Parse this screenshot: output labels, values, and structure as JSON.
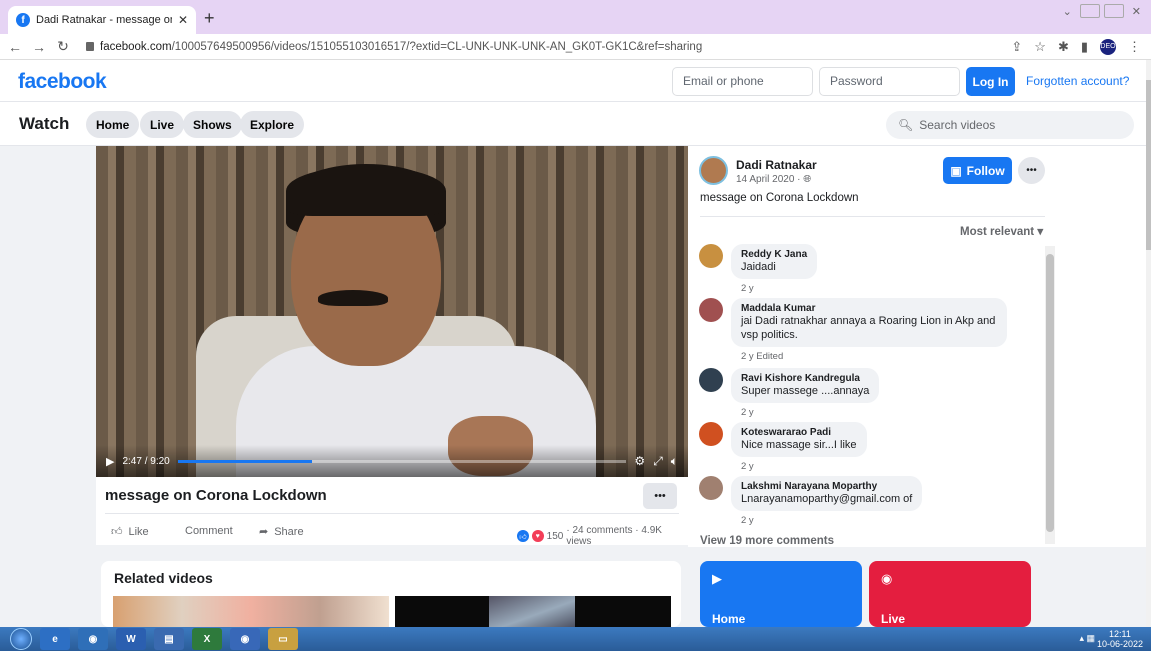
{
  "browser": {
    "tab_title": "Dadi Ratnakar - message on Cor",
    "url_host": "facebook.com",
    "url_path": "/100057649500956/videos/151055103016517/?extid=CL-UNK-UNK-UNK-AN_GK0T-GK1C&ref=sharing"
  },
  "header": {
    "logo": "facebook",
    "email_placeholder": "Email or phone",
    "password_placeholder": "Password",
    "login_label": "Log In",
    "forgot_label": "Forgotten account?"
  },
  "watch": {
    "title": "Watch",
    "nav": [
      "Home",
      "Live",
      "Shows",
      "Explore"
    ],
    "search_placeholder": "Search videos"
  },
  "video": {
    "time": "2:47 / 9:20",
    "progress": 0.3,
    "title": "message on Corona Lockdown",
    "actions": {
      "like": "Like",
      "comment": "Comment",
      "share": "Share"
    },
    "reactions_count": "150",
    "stats": "· 24 comments · 4.9K views"
  },
  "post": {
    "author": "Dadi Ratnakar",
    "date": "14 April 2020 · ",
    "description": "message on Corona Lockdown",
    "follow_label": "Follow",
    "sort_label": "Most relevant",
    "view_more": "View 19 more comments"
  },
  "comments": [
    {
      "name": "Reddy K Jana",
      "text": "Jaidadi",
      "meta": "2 y",
      "color": "#c89040"
    },
    {
      "name": "Maddala Kumar",
      "text": "jai Dadi ratnakhar annaya a Roaring Lion in Akp and vsp politics.",
      "meta": "2 y   Edited",
      "color": "#a05050"
    },
    {
      "name": "Ravi Kishore Kandregula",
      "text": "Super massege ....annaya",
      "meta": "2 y",
      "color": "#304050"
    },
    {
      "name": "Koteswararao Padi",
      "text": "Nice massage sir...I like",
      "meta": "2 y",
      "color": "#d05020"
    },
    {
      "name": "Lakshmi Narayana Moparthy",
      "text": "Lnarayanamoparthy@gmail.com of",
      "meta": "2 y",
      "color": "#a08070"
    }
  ],
  "related": {
    "title": "Related videos"
  },
  "navcards": [
    {
      "label": "Home",
      "color": "#1877f2",
      "icon": "play-icon"
    },
    {
      "label": "Live",
      "color": "#e41e3f",
      "icon": "live-icon"
    }
  ],
  "taskbar": {
    "time": "12:11",
    "date": "10-06-2022"
  }
}
